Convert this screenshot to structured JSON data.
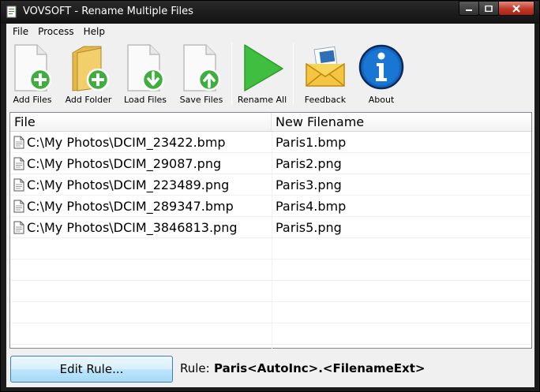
{
  "window": {
    "title": "VOVSOFT - Rename Multiple Files"
  },
  "menu": [
    "File",
    "Process",
    "Help"
  ],
  "toolbar": {
    "add_files": "Add Files",
    "add_folder": "Add Folder",
    "load_files": "Load Files",
    "save_files": "Save Files",
    "rename_all": "Rename All",
    "feedback": "Feedback",
    "about": "About"
  },
  "list": {
    "columns": [
      "File",
      "New Filename"
    ],
    "rows": [
      {
        "file": "C:\\My Photos\\DCIM_23422.bmp",
        "new_name": "Paris1.bmp"
      },
      {
        "file": "C:\\My Photos\\DCIM_29087.png",
        "new_name": "Paris2.png"
      },
      {
        "file": "C:\\My Photos\\DCIM_223489.png",
        "new_name": "Paris3.png"
      },
      {
        "file": "C:\\My Photos\\DCIM_289347.bmp",
        "new_name": "Paris4.bmp"
      },
      {
        "file": "C:\\My Photos\\DCIM_3846813.png",
        "new_name": "Paris5.png"
      }
    ]
  },
  "bottom": {
    "edit_rule_label": "Edit Rule...",
    "rule_label": "Rule:",
    "rule_value": "Paris<AutoInc>.<FilenameExt>"
  },
  "colors": {
    "accent_green": "#3fae3f",
    "info_blue": "#1565c0",
    "close_red": "#c0392b"
  }
}
